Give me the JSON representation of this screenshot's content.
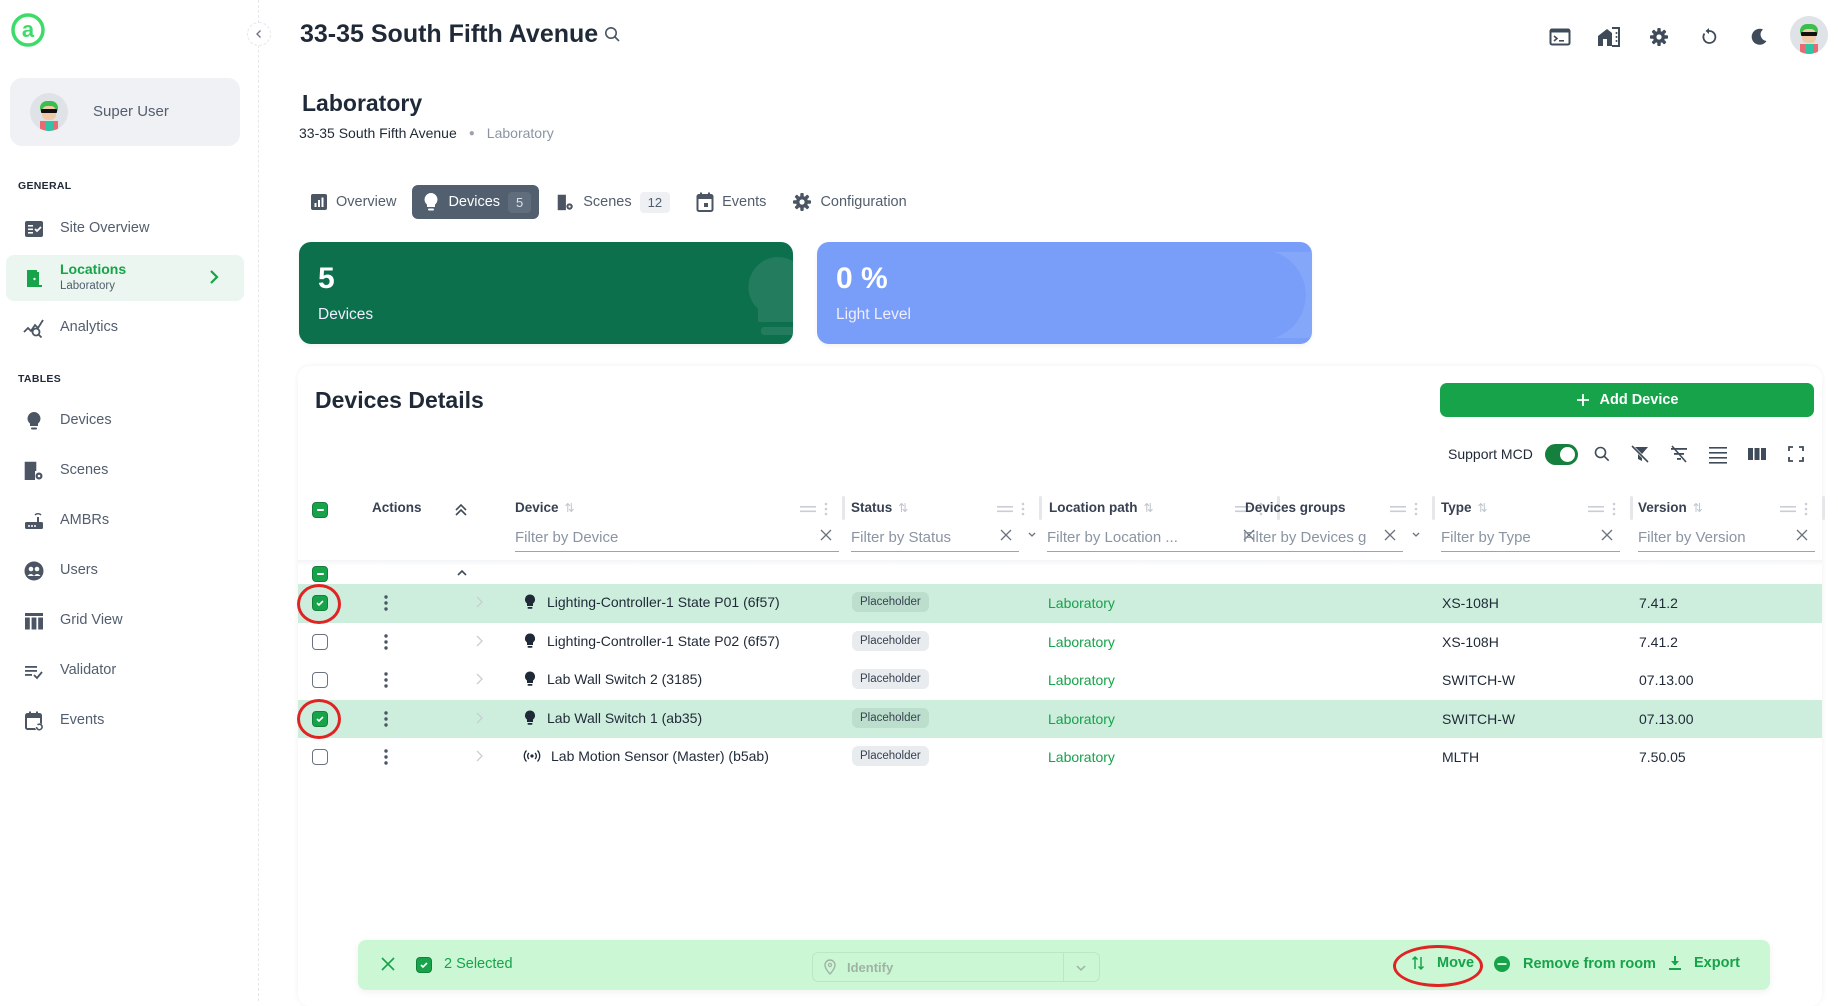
{
  "app": {
    "brand_icon": "at-logo-icon"
  },
  "sidebar": {
    "user": {
      "name": "Super User",
      "avatar": "avatar-icon"
    },
    "sections": [
      {
        "label": "GENERAL"
      },
      {
        "label": "TABLES"
      }
    ],
    "general_items": [
      {
        "label": "Site Overview",
        "icon": "checklist-icon"
      },
      {
        "label": "Locations",
        "sublabel": "Laboratory",
        "icon": "door-icon",
        "active": true
      },
      {
        "label": "Analytics",
        "icon": "analytics-icon"
      }
    ],
    "table_items": [
      {
        "label": "Devices",
        "icon": "bulb-icon"
      },
      {
        "label": "Scenes",
        "icon": "scenes-icon"
      },
      {
        "label": "AMBRs",
        "icon": "router-icon"
      },
      {
        "label": "Users",
        "icon": "users-icon"
      },
      {
        "label": "Grid View",
        "icon": "grid-icon"
      },
      {
        "label": "Validator",
        "icon": "validator-icon"
      },
      {
        "label": "Events",
        "icon": "calendar-icon"
      }
    ]
  },
  "header": {
    "site_title": "33-35 South Fifth Avenue",
    "top_icons": [
      "terminal-icon",
      "building-icon",
      "gear-icon",
      "refresh-icon",
      "moon-icon",
      "avatar-icon"
    ]
  },
  "page": {
    "title": "Laboratory",
    "breadcrumb": [
      "33-35 South Fifth Avenue",
      "Laboratory"
    ],
    "tabs": [
      {
        "label": "Overview",
        "icon": "chart-icon"
      },
      {
        "label": "Devices",
        "badge": "5",
        "icon": "bulb-icon",
        "active": true
      },
      {
        "label": "Scenes",
        "badge": "12",
        "icon": "scenes-icon"
      },
      {
        "label": "Events",
        "icon": "calendar-icon"
      },
      {
        "label": "Configuration",
        "icon": "gear-icon"
      }
    ]
  },
  "stats": [
    {
      "value": "5",
      "label": "Devices",
      "color": "#0d704d"
    },
    {
      "value": "0 %",
      "label": "Light Level",
      "color": "#789ef9"
    }
  ],
  "table": {
    "title": "Devices Details",
    "add_button": "Add Device",
    "support_mcd_label": "Support MCD",
    "support_mcd_on": true,
    "actions_header": "Actions",
    "columns": [
      {
        "label": "Device",
        "filter_placeholder": "Filter by Device"
      },
      {
        "label": "Status",
        "filter_placeholder": "Filter by Status"
      },
      {
        "label": "Location path",
        "filter_placeholder": "Filter by Location ..."
      },
      {
        "label": "Devices groups",
        "filter_placeholder": "Filter by Devices g"
      },
      {
        "label": "Type",
        "filter_placeholder": "Filter by Type"
      },
      {
        "label": "Version",
        "filter_placeholder": "Filter by Version"
      }
    ],
    "rows": [
      {
        "device": "Lighting-Controller-1 State P01 (6f57)",
        "icon": "bulb-icon",
        "status": "Placeholder",
        "location": "Laboratory",
        "groups": "",
        "type": "XS-108H",
        "version": "7.41.2",
        "selected": true
      },
      {
        "device": "Lighting-Controller-1 State P02 (6f57)",
        "icon": "bulb-icon",
        "status": "Placeholder",
        "location": "Laboratory",
        "groups": "",
        "type": "XS-108H",
        "version": "7.41.2",
        "selected": false
      },
      {
        "device": "Lab Wall Switch 2 (3185)",
        "icon": "bulb-icon",
        "status": "Placeholder",
        "location": "Laboratory",
        "groups": "",
        "type": "SWITCH-W",
        "version": "07.13.00",
        "selected": false
      },
      {
        "device": "Lab Wall Switch 1 (ab35)",
        "icon": "bulb-icon",
        "status": "Placeholder",
        "location": "Laboratory",
        "groups": "",
        "type": "SWITCH-W",
        "version": "07.13.00",
        "selected": true
      },
      {
        "device": "Lab Motion Sensor (Master) (b5ab)",
        "icon": "sensor-icon",
        "status": "Placeholder",
        "location": "Laboratory",
        "groups": "",
        "type": "MLTH",
        "version": "7.50.05",
        "selected": false
      }
    ]
  },
  "selection_bar": {
    "count_label": "2 Selected",
    "identify_placeholder": "Identify",
    "actions": [
      {
        "label": "Move",
        "icon": "move-icon"
      },
      {
        "label": "Remove from room",
        "icon": "remove-circle-icon"
      },
      {
        "label": "Export",
        "icon": "download-icon"
      }
    ]
  },
  "colors": {
    "accent": "#16a34a",
    "selected_row": "#cdeedd",
    "highlight_ring": "#e02424"
  }
}
